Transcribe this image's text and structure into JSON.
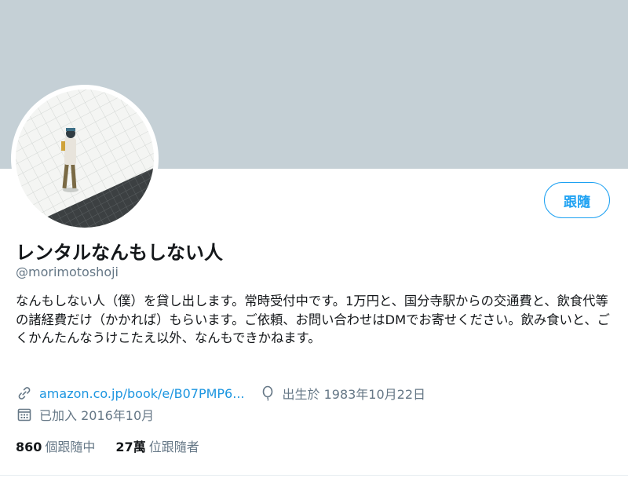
{
  "profile": {
    "name": "レンタルなんもしない人",
    "handle": "@morimotoshoji",
    "bio": "なんもしない人（僕）を貸し出します。常時受付中です。1万円と、国分寺駅からの交通費と、飲食代等の諸経費だけ（かかれば）もらいます。ご依頼、お問い合わせはDMでお寄せください。飲み食いと、ごくかんたんなうけこたえ以外、なんもできかねます。",
    "link": "amazon.co.jp/book/e/B07PMP6...",
    "birth": "出生於 1983年10月22日",
    "joined": "已加入 2016年10月"
  },
  "actions": {
    "follow_label": "跟隨"
  },
  "stats": {
    "following_count": "860",
    "following_label": "個跟隨中",
    "followers_count": "27萬",
    "followers_label": "位跟隨者"
  },
  "icons": {
    "link": "link-icon",
    "birthday": "balloon-icon",
    "calendar": "calendar-icon"
  },
  "colors": {
    "banner": "#c5d0d6",
    "accent": "#1da1f2",
    "link": "#1b95e0",
    "secondary_text": "#657786"
  }
}
